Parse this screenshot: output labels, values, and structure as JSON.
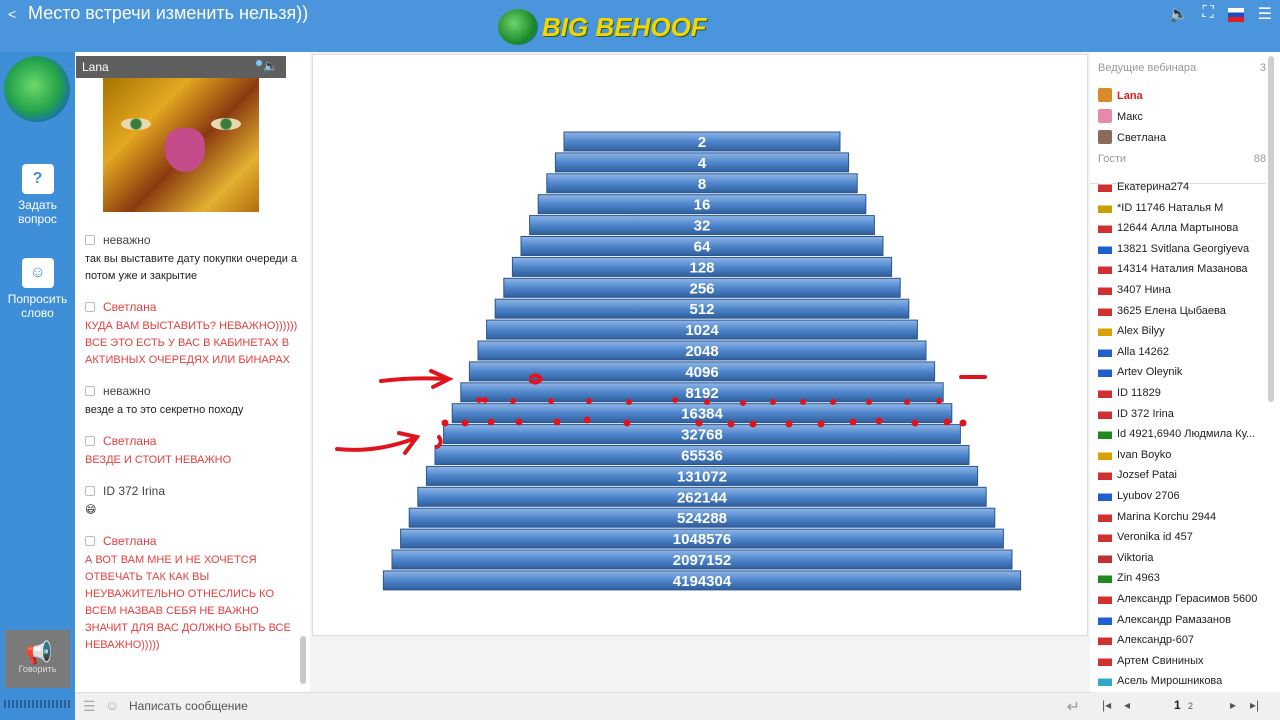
{
  "topbar": {
    "title": "Место встречи изменить нельзя))",
    "logo_text": "BIG BEHOOF"
  },
  "leftnav": {
    "ask_label_1": "Задать",
    "ask_label_2": "вопрос",
    "speak_label_1": "Попросить",
    "speak_label_2": "слово",
    "talk_label": "Говорить"
  },
  "video": {
    "name": "Lana"
  },
  "chat": {
    "messages": [
      {
        "author": "неважно",
        "text": "так вы выставите дату покупки очереди а потом уже и закрытие"
      },
      {
        "author": "Светлана",
        "text": "КУДА ВАМ ВЫСТАВИТЬ? НЕВАЖНО)))))) ВСЕ ЭТО ЕСТЬ У ВАС В КАБИНЕТАХ В АКТИВНЫХ ОЧЕРЕДЯХ ИЛИ БИНАРАХ"
      },
      {
        "author": "неважно",
        "text": "везде а то это секретно походу"
      },
      {
        "author": "Светлана",
        "text": "ВЕЗДЕ И СТОИТ НЕВАЖНО"
      },
      {
        "author": "ID 372 Irina",
        "text": "😄"
      },
      {
        "author": "Светлана",
        "text": "А ВОТ ВАМ МНЕ И НЕ ХОЧЕТСЯ ОТВЕЧАТЬ ТАК КАК ВЫ НЕУВАЖИТЕЛЬНО ОТНЕСЛИСЬ КО ВСЕМ НАЗВАВ СЕБЯ НЕ ВАЖНО ЗНАЧИТ ДЛЯ ВАС ДОЛЖНО БЫТЬ ВСЕ НЕВАЖНО)))))"
      }
    ],
    "compose_placeholder": "Написать сообщение"
  },
  "pyramid": {
    "levels": [
      "2",
      "4",
      "8",
      "16",
      "32",
      "64",
      "128",
      "256",
      "512",
      "1024",
      "2048",
      "4096",
      "8192",
      "16384",
      "32768",
      "65536",
      "131072",
      "262144",
      "524288",
      "1048576",
      "2097152",
      "4194304"
    ]
  },
  "sidebar": {
    "hosts_header": "Ведущие вебинара",
    "hosts_count": "3",
    "hosts": [
      "Lana",
      "Макс",
      "Светлана"
    ],
    "guests_header": "Гости",
    "guests_count": "88",
    "guests": [
      "Екатерина274",
      "*ID 11746 Наталья М",
      "12644 Алла Мартынова",
      "13821 Svitlana Georgiyeva",
      "14314 Наталия Мазанова",
      "3407 Нина",
      "3625 Елена Цыбаева",
      "Alex Bilyy",
      "Alla 14262",
      "Artev Oleynik",
      "ID 11829",
      "ID 372 Irina",
      "Id 4921,6940 Людмила Ку...",
      "Ivan Boyko",
      "Jozsef Patai",
      "Lyubov 2706",
      "Marina Korchu 2944",
      "Veronika id 457",
      "Viktoria",
      "Zin 4963",
      "Александр Герасимов 5600",
      "Александр Рамазанов",
      "Александр-607",
      "Артем Свининых",
      "Асель Мирошникова"
    ],
    "guest_flag_colors": [
      "#d03030",
      "#c8a000",
      "#d03030",
      "#1f5fd0",
      "#d03030",
      "#d03030",
      "#d03030",
      "#d8a000",
      "#1f5fd0",
      "#1f5fd0",
      "#d03030",
      "#d03030",
      "#1f8a1f",
      "#d8a000",
      "#d03030",
      "#1f5fd0",
      "#d03030",
      "#d03030",
      "#c03030",
      "#1f8a1f",
      "#d03030",
      "#1f5fd0",
      "#d03030",
      "#d03030",
      "#30a8c8"
    ],
    "page_current": "1",
    "page_next": "2"
  }
}
